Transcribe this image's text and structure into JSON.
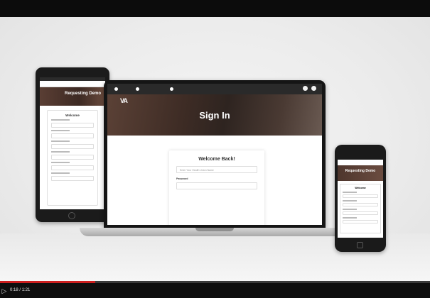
{
  "player": {
    "current_time": "0:18",
    "separator": "/",
    "duration": "1:21",
    "progress_fraction": 0.222,
    "progress_color": "#cc1f1f",
    "play_icon": "play-icon"
  },
  "laptop": {
    "logo_mark": "VA",
    "page_title": "Sign In",
    "card_title": "Welcome Back!",
    "username_placeholder": "Enter Your Health Union Name",
    "password_label": "Password"
  },
  "tablet": {
    "page_title": "Requesting Demo",
    "card_title": "Welcome"
  },
  "phone": {
    "page_title": "Requesting Demo",
    "card_title": "Welcome"
  }
}
